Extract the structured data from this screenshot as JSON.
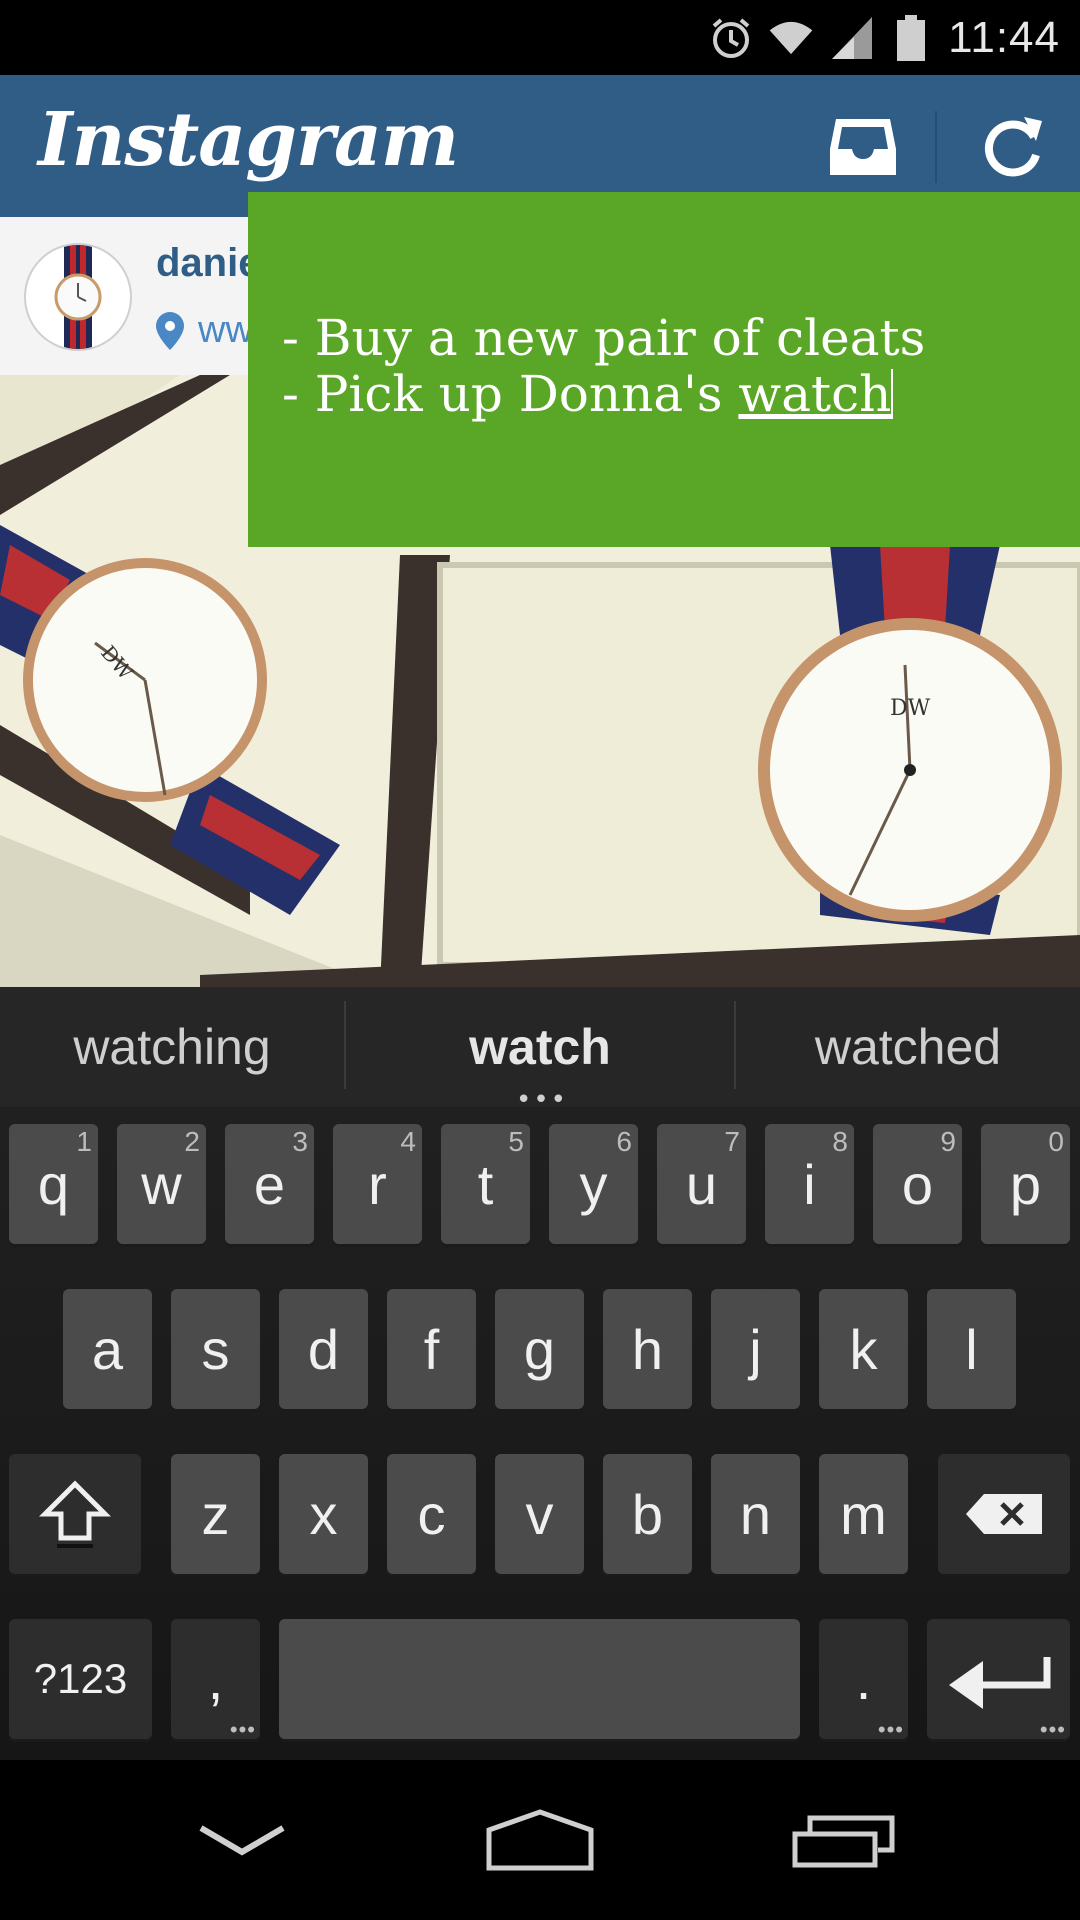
{
  "status_bar": {
    "time": "11:44",
    "icons": [
      "alarm-icon",
      "wifi-icon",
      "signal-icon",
      "battery-icon"
    ]
  },
  "instagram": {
    "logo": "Instagram",
    "icons": [
      "inbox-icon",
      "refresh-icon"
    ],
    "post": {
      "username_visible": "danie",
      "location_visible": "ww"
    },
    "brand_color": "#2f5d86"
  },
  "note": {
    "line1": "- Buy a new pair of cleats",
    "line2_prefix": "- Pick up Donna's ",
    "line2_word": "watch",
    "bg_color": "#5aa626"
  },
  "keyboard": {
    "suggestions": [
      "watching",
      "watch",
      "watched"
    ],
    "row1": [
      {
        "k": "q",
        "h": "1"
      },
      {
        "k": "w",
        "h": "2"
      },
      {
        "k": "e",
        "h": "3"
      },
      {
        "k": "r",
        "h": "4"
      },
      {
        "k": "t",
        "h": "5"
      },
      {
        "k": "y",
        "h": "6"
      },
      {
        "k": "u",
        "h": "7"
      },
      {
        "k": "i",
        "h": "8"
      },
      {
        "k": "o",
        "h": "9"
      },
      {
        "k": "p",
        "h": "0"
      }
    ],
    "row2": [
      "a",
      "s",
      "d",
      "f",
      "g",
      "h",
      "j",
      "k",
      "l"
    ],
    "row3": [
      "z",
      "x",
      "c",
      "v",
      "b",
      "n",
      "m"
    ],
    "symbols_label": "?123",
    "comma_label": ",",
    "period_label": "."
  },
  "nav_bar": {
    "icons": [
      "back-icon",
      "home-icon",
      "recents-icon"
    ]
  }
}
